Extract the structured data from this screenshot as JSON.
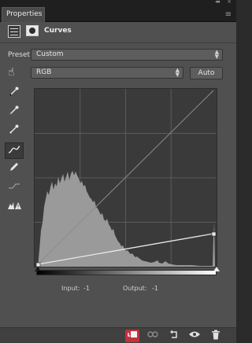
{
  "window": {
    "collapse_glyph": "◂◂",
    "close_glyph": "×"
  },
  "tab": {
    "label": "Properties",
    "menu_glyph": "≡"
  },
  "header": {
    "title": "Curves",
    "adjustment_icon": "curves-adjustment-icon",
    "mask_icon": "layer-mask-icon"
  },
  "preset": {
    "label": "Preset:",
    "value": "Custom"
  },
  "channel": {
    "value": "RGB"
  },
  "auto_label": "Auto",
  "tools": [
    {
      "name": "on-image-adjust-icon"
    },
    {
      "name": "black-point-eyedropper-icon"
    },
    {
      "name": "gray-point-eyedropper-icon"
    },
    {
      "name": "white-point-eyedropper-icon"
    },
    {
      "name": "curve-points-tool-icon"
    },
    {
      "name": "pencil-tool-icon"
    },
    {
      "name": "smooth-curve-icon"
    },
    {
      "name": "clipping-warning-icon"
    }
  ],
  "info": {
    "input_label": "Input:",
    "input_value": "-1",
    "output_label": "Output:",
    "output_value": "-1"
  },
  "bottom_icons": [
    "clip-to-layer-icon",
    "view-previous-state-icon",
    "reset-icon",
    "visibility-icon",
    "delete-icon"
  ],
  "colors": {
    "panel": "#505050",
    "graph_bg": "#3a3a3a",
    "highlight": "#c0333a"
  }
}
